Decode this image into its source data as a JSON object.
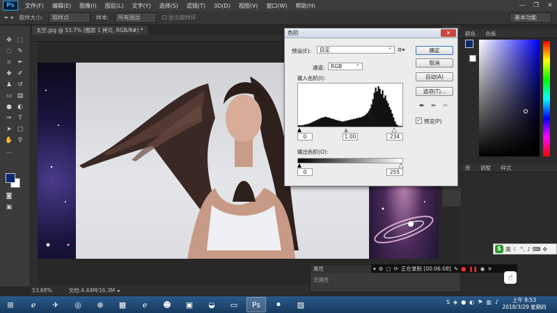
{
  "menubar": {
    "logo": "Ps",
    "items": [
      "文件(F)",
      "编辑(E)",
      "图像(I)",
      "图层(L)",
      "文字(Y)",
      "选择(S)",
      "滤镜(T)",
      "3D(D)",
      "视图(V)",
      "窗口(W)",
      "帮助(H)"
    ]
  },
  "options": {
    "size_label": "取样大小:",
    "size_value": "取样点",
    "sample_label": "样本:",
    "sample_value": "所有图层",
    "ring_label": "显示取样环",
    "workspace": "基本功能"
  },
  "document": {
    "tab_title": "太空.jpg @ 53.7% (图层 1 拷贝, RGB/8#) *",
    "zoom": "53.68%",
    "doc_info": "文档:4.44M/16.3M"
  },
  "dialog": {
    "title": "色阶",
    "preset_label": "预设(E):",
    "preset_value": "自定",
    "channel_label": "通道:",
    "channel_value": "RGB",
    "input_label": "输入色阶(I):",
    "input_black": "0",
    "input_gamma": "1.00",
    "input_white": "234",
    "output_label": "输出色阶(O):",
    "output_black": "0",
    "output_white": "255",
    "ok": "确定",
    "cancel": "取消",
    "auto": "自动(A)",
    "options": "选项(T)...",
    "preview": "预览(P)",
    "preview_checked": true
  },
  "panels": {
    "color_tab": "颜色",
    "swatches_tab": "色板",
    "lib_tab": "库",
    "adjust_tab": "调整",
    "style_tab": "样式",
    "props_title": "属性",
    "props_body": "无属性"
  },
  "recorder": {
    "status": "正在录制 [00:06:08]"
  },
  "ime": {
    "logo": "S",
    "mode": "英"
  },
  "taskbar": {
    "time": "上午 8:53",
    "date": "2018/3/29 星期四"
  },
  "histogram": [
    2,
    2,
    2,
    2,
    3,
    3,
    4,
    4,
    5,
    6,
    7,
    8,
    9,
    10,
    11,
    12,
    13,
    14,
    14,
    15,
    15,
    14,
    14,
    13,
    12,
    12,
    11,
    10,
    10,
    9,
    9,
    8,
    8,
    8,
    9,
    9,
    10,
    10,
    11,
    11,
    12,
    12,
    13,
    13,
    14,
    14,
    15,
    16,
    17,
    19,
    21,
    24,
    28,
    34,
    42,
    52,
    60,
    54,
    62,
    58,
    50,
    56,
    44,
    48,
    40,
    36,
    30,
    26,
    20,
    14,
    8,
    4,
    2,
    1,
    1,
    1
  ],
  "colors": {
    "foreground": "#0c2a6b",
    "background": "#ffffff",
    "accent": "#2b6fc8"
  }
}
